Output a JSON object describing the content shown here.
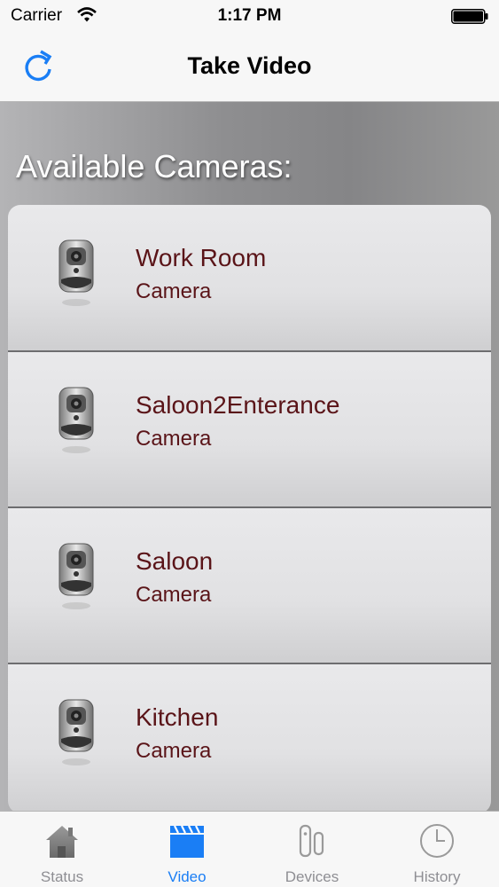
{
  "status_bar": {
    "carrier": "Carrier",
    "time": "1:17 PM"
  },
  "nav": {
    "title": "Take Video",
    "refresh_icon": "refresh-icon"
  },
  "content": {
    "heading": "Available Cameras:"
  },
  "cameras": [
    {
      "name": "Work Room",
      "type": "Camera"
    },
    {
      "name": "Saloon2Enterance",
      "type": "Camera"
    },
    {
      "name": "Saloon",
      "type": "Camera"
    },
    {
      "name": "Kitchen",
      "type": "Camera"
    }
  ],
  "tabs": [
    {
      "label": "Status",
      "icon": "house-icon",
      "active": false
    },
    {
      "label": "Video",
      "icon": "clapperboard-icon",
      "active": true
    },
    {
      "label": "Devices",
      "icon": "door-sensor-icon",
      "active": false
    },
    {
      "label": "History",
      "icon": "clock-icon",
      "active": false
    }
  ],
  "colors": {
    "accent": "#1a7ef5",
    "row_text": "#5a1418",
    "inactive_tab": "#8e8e93"
  }
}
